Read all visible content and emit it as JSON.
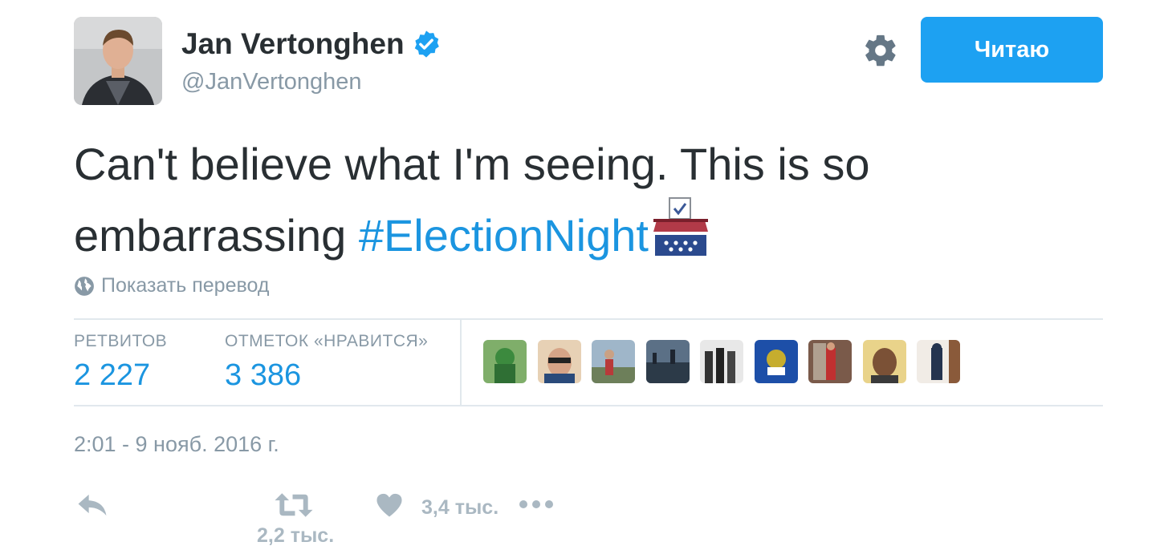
{
  "user": {
    "name": "Jan Vertonghen",
    "handle": "@JanVertonghen",
    "verified": true
  },
  "header": {
    "follow_label": "Читаю"
  },
  "tweet": {
    "text": "Can't believe what I'm seeing. This is so embarrassing ",
    "hashtag": "#ElectionNight",
    "emoji_icon": "ballot-box-icon",
    "translate_label": "Показать перевод",
    "timestamp": "2:01 - 9 нояб. 2016 г."
  },
  "stats": {
    "retweets_label": "РЕТВИТОВ",
    "retweets_value": "2 227",
    "likes_label": "ОТМЕТОК «НРАВИТСЯ»",
    "likes_value": "3 386"
  },
  "liker_avatars_count": 9,
  "actions": {
    "retweet_count": "2,2 тыс.",
    "like_count": "3,4 тыс."
  },
  "colors": {
    "accent": "#1da1f2",
    "link": "#1b95e0",
    "muted": "#8899a6",
    "icon": "#aab8c2"
  }
}
